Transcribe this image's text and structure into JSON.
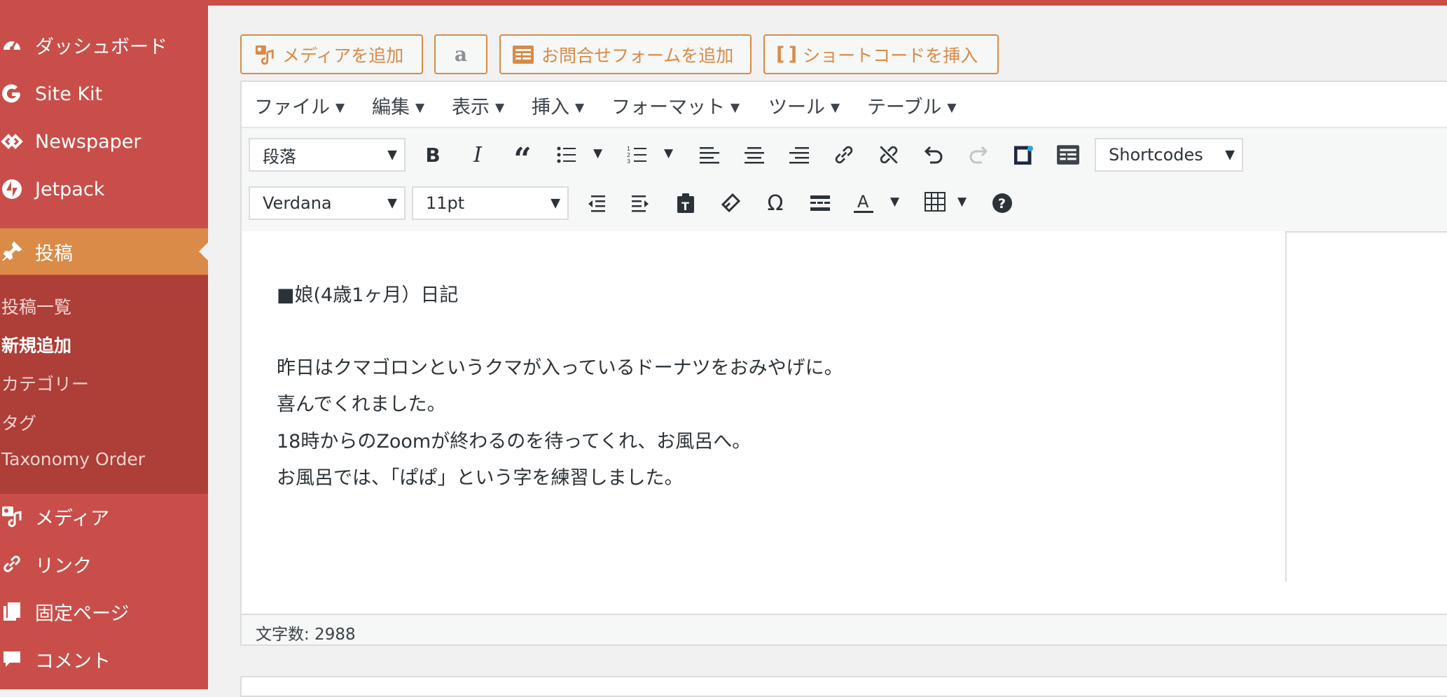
{
  "sidebar": {
    "items": [
      {
        "label": "ダッシュボード",
        "icon": "dashboard-icon"
      },
      {
        "label": "Site Kit",
        "icon": "google-g-icon"
      },
      {
        "label": "Newspaper",
        "icon": "newspaper-icon"
      },
      {
        "label": "Jetpack",
        "icon": "jetpack-icon"
      },
      {
        "label": "投稿",
        "icon": "pin-icon",
        "active": true
      },
      {
        "label": "メディア",
        "icon": "media-icon"
      },
      {
        "label": "リンク",
        "icon": "link-icon"
      },
      {
        "label": "固定ページ",
        "icon": "pages-icon"
      },
      {
        "label": "コメント",
        "icon": "comment-icon"
      }
    ],
    "submenu": [
      {
        "label": "投稿一覧"
      },
      {
        "label": "新規追加",
        "current": true
      },
      {
        "label": "カテゴリー"
      },
      {
        "label": "タグ"
      },
      {
        "label": "Taxonomy Order"
      }
    ]
  },
  "media_buttons": {
    "add_media": "メディアを追加",
    "amazon_icon_glyph": "a",
    "add_contact_form": "お問合せフォームを追加",
    "insert_shortcode": "ショートコードを挿入",
    "shortcode_bracket": "[ ]"
  },
  "editor": {
    "menubar": [
      "ファイル",
      "編集",
      "表示",
      "挿入",
      "フォーマット",
      "ツール",
      "テーブル"
    ],
    "caret": "▼",
    "toolbar": {
      "format_select": "段落",
      "shortcodes_select": "Shortcodes",
      "font_family": "Verdana",
      "font_size": "11pt"
    },
    "content": {
      "lines": [
        "■娘(4歳1ヶ月）日記",
        "",
        "昨日はクマゴロンというクマが入っているドーナツをおみやげに。",
        "喜んでくれました。",
        "18時からのZoomが終わるのを待ってくれ、お風呂へ。",
        "お風呂では、「ぱぱ」という字を練習しました。"
      ]
    },
    "status": "文字数: 2988"
  },
  "colors": {
    "sidebar_bg": "#c94e4a",
    "sidebar_active": "#d98b47",
    "submenu_bg": "#ad3e38",
    "accent": "#d98b47"
  }
}
